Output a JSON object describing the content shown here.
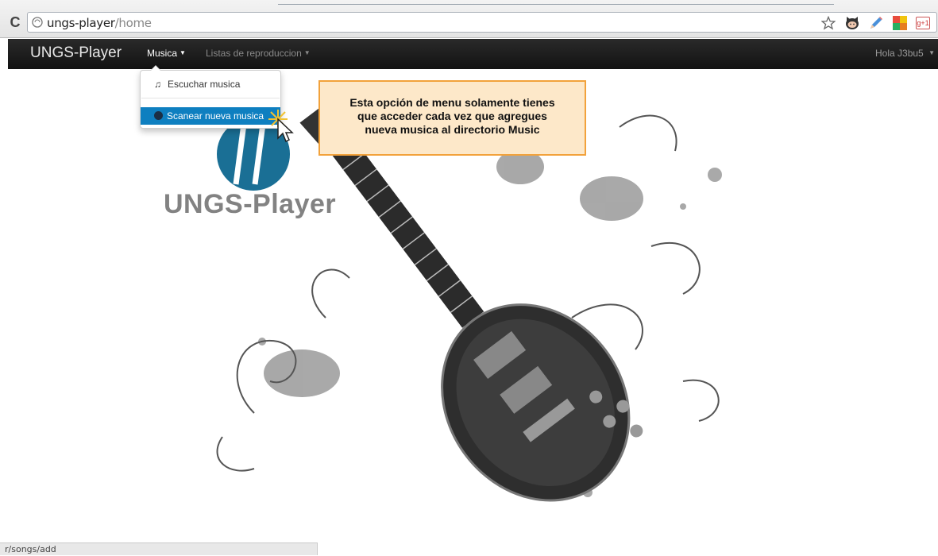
{
  "browser": {
    "url_host": "ungs-player",
    "url_path": "/home",
    "reload_glyph": "C",
    "extension_icons": [
      "star-icon",
      "octocat-icon",
      "pencil-icon",
      "color-picker-icon",
      "google-plus-icon"
    ],
    "gplus_label": "g+1"
  },
  "navbar": {
    "brand": "UNGS-Player",
    "menu_musica": "Musica",
    "menu_listas": "Listas de reproduccion",
    "user_greeting": "Hola J3bu5"
  },
  "dropdown": {
    "item_listen": "Escuchar musica",
    "item_scan": "Scanear nueva musica"
  },
  "logo": {
    "text": "UNGS-Player",
    "color": "#1a6f95"
  },
  "callout": {
    "line1": "Esta opción de menu solamente tienes",
    "line2": "que acceder cada vez que agregues",
    "line3": "nueva musica al directorio Music"
  },
  "status_bar": {
    "text": "r/songs/add"
  },
  "colors": {
    "navbar": "#1b1b1b",
    "dropdown_active": "#0e7fc0",
    "callout_bg": "#fde8c9",
    "callout_border": "#f2a23b"
  }
}
